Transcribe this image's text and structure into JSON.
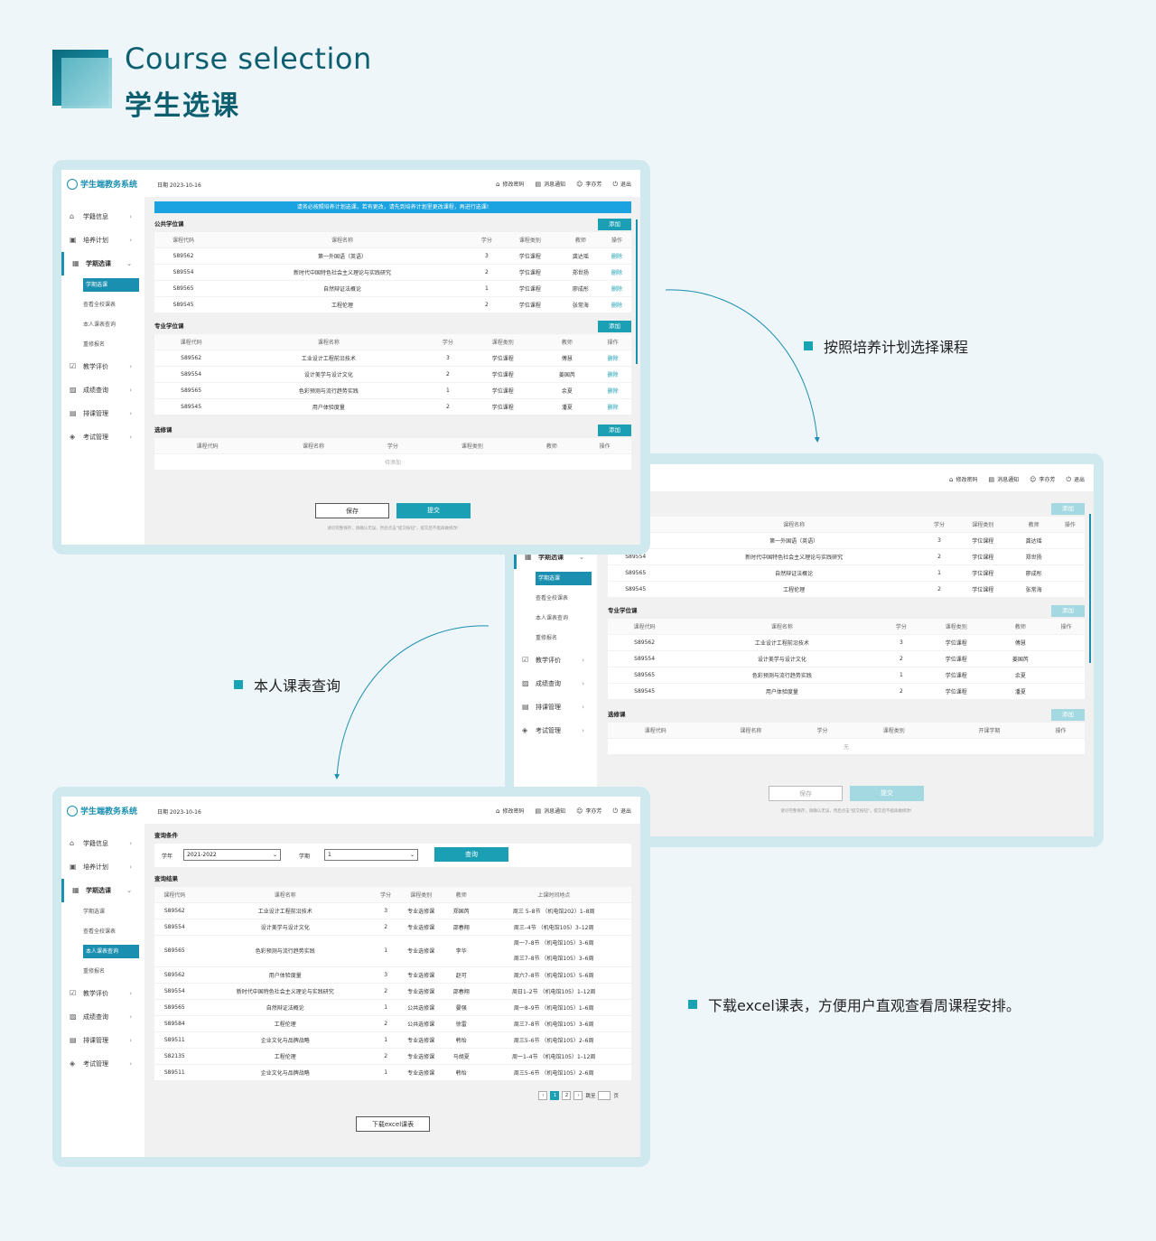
{
  "hero": {
    "title_en": "Course selection",
    "title_cn": "学生选课"
  },
  "annotations": {
    "a1": "按照培养计划选择课程",
    "a2": "本人课表查询",
    "a3": "下载excel课表，方便用户直观查看周课程安排。"
  },
  "app": {
    "logo": "学生端教务系统",
    "date": "日期  2023-10-16",
    "actions": [
      {
        "icon": "⌂",
        "label": "修改密码"
      },
      {
        "icon": "▤",
        "label": "消息通知"
      },
      {
        "icon": "☺",
        "label": "李亦芳"
      },
      {
        "icon": "⏻",
        "label": "退出"
      }
    ],
    "sidebar": {
      "items": [
        "学籍信息",
        "培养计划",
        "学期选课",
        "教学评价",
        "成绩查询",
        "排课管理",
        "考试管理"
      ],
      "subs": [
        "学期选课",
        "查看全校课表",
        "本人课表查询",
        "重修报名"
      ]
    }
  },
  "screen1": {
    "banner": "请务必按照培养计划选课，若有更改，请先到培养计划里更改课程，再进行选课!",
    "add_label": "添加",
    "headers": [
      "课程代码",
      "课程名称",
      "学分",
      "课程类别",
      "教师",
      "操作"
    ],
    "sections": [
      {
        "title": "公共学位课",
        "rows": [
          [
            "S89562",
            "第一外国语（英语）",
            "3",
            "学位课程",
            "龚达瑶",
            "删除"
          ],
          [
            "S89554",
            "新时代中国特色社会主义理论与实践研究",
            "2",
            "学位课程",
            "郑世扬",
            "删除"
          ],
          [
            "S89565",
            "自然辩证法概论",
            "1",
            "学位课程",
            "廖成彤",
            "删除"
          ],
          [
            "S89545",
            "工程伦理",
            "2",
            "学位课程",
            "张常海",
            "删除"
          ]
        ]
      },
      {
        "title": "专业学位课",
        "rows": [
          [
            "S89562",
            "工业设计工程前沿技术",
            "3",
            "学位课程",
            "傅慧",
            "删除"
          ],
          [
            "S89554",
            "设计美学与设计文化",
            "2",
            "学位课程",
            "姜国芮",
            "删除"
          ],
          [
            "S89565",
            "色彩预测与流行趋势实践",
            "1",
            "学位课程",
            "余夏",
            "删除"
          ],
          [
            "S89545",
            "用户体验度量",
            "2",
            "学位课程",
            "潘夏",
            "删除"
          ]
        ]
      }
    ],
    "elective_title": "选修课",
    "elective_empty": "待添加",
    "save": "保存",
    "submit": "提交",
    "note": "请尽完整保存，请确认无误，然后点击\"提交按钮\"，提交后不能再做修改!"
  },
  "screen2": {
    "headers1": [
      "",
      "课程名称",
      "学分",
      "课程类别",
      "教师",
      "操作"
    ],
    "headers2": [
      "课程代码",
      "课程名称",
      "学分",
      "课程类别",
      "教师",
      "操作"
    ],
    "headers3": [
      "课程代码",
      "课程名称",
      "学分",
      "课程类别",
      "开课学期",
      "操作"
    ],
    "sec2_title": "专业学位课",
    "sec3_title": "选修课",
    "rows1": [
      [
        "",
        "第一外国语（英语）",
        "3",
        "学位课程",
        "龚达瑶"
      ],
      [
        "S89554",
        "新时代中国特色社会主义理论与实践研究",
        "2",
        "学位课程",
        "郑世扬"
      ],
      [
        "S89565",
        "自然辩证法概论",
        "1",
        "学位课程",
        "廖成彤"
      ],
      [
        "S89545",
        "工程伦理",
        "2",
        "学位课程",
        "张常海"
      ]
    ],
    "rows2": [
      [
        "S89562",
        "工业设计工程前沿技术",
        "3",
        "学位课程",
        "傅慧"
      ],
      [
        "S89554",
        "设计美学与设计文化",
        "2",
        "学位课程",
        "姜国芮"
      ],
      [
        "S89565",
        "色彩预测与流行趋势实践",
        "1",
        "学位课程",
        "余夏"
      ],
      [
        "S89545",
        "用户体验度量",
        "2",
        "学位课程",
        "潘夏"
      ]
    ],
    "empty": "无",
    "note": "请尽完整保存，请确认无误，然后点击\"提交按钮\"，提交后不能再做修改!"
  },
  "screen3": {
    "filter_title": "查询条件",
    "year_label": "学年",
    "year_value": "2021-2022",
    "term_label": "学期",
    "term_value": "1",
    "query": "查询",
    "result_title": "查询结果",
    "headers": [
      "课程代码",
      "课程名称",
      "学分",
      "课程类别",
      "教师",
      "上课时间地点"
    ],
    "rows": [
      [
        "S89562",
        "工业设计工程前沿技术",
        "3",
        "专业选修课",
        "郑国芮",
        "周三 5–8节 （机电馆202）1–8周"
      ],
      [
        "S89554",
        "设计美学与设计文化",
        "2",
        "专业选修课",
        "邵春翔",
        "周三–4节 （机电馆105）3–12周"
      ],
      [
        "S89565",
        "色彩预测与流行趋势实践",
        "1",
        "专业选修课",
        "李华",
        "周一7–8节 （机电馆105）3–6周\n周三7–8节 （机电馆105）3–6周"
      ],
      [
        "S89562",
        "用户体验度量",
        "3",
        "专业选修课",
        "赵可",
        "周六7–8节 （机电馆105）5–6周"
      ],
      [
        "S89554",
        "新时代中国特色社会主义理论与实践研究",
        "2",
        "专业选修课",
        "邵春翔",
        "周日1–2节 （机电馆105）1–12周"
      ],
      [
        "S89565",
        "自然辩证法概论",
        "1",
        "公共选修课",
        "晏强",
        "周一8–9节 （机电馆105）1–6周"
      ],
      [
        "S89584",
        "工程伦理",
        "2",
        "公共选修课",
        "徐雷",
        "周三7–8节 （机电馆105）3–6周"
      ],
      [
        "S89511",
        "企业文化与品牌战略",
        "1",
        "专业选修课",
        "韩怡",
        "周三5–6节 （机电馆105）2–6周"
      ],
      [
        "S82135",
        "工程伦理",
        "2",
        "专业选修课",
        "马胡夏",
        "周一1–4节 （机电馆105）1–12周"
      ],
      [
        "S89511",
        "企业文化与品牌战略",
        "1",
        "专业选修课",
        "韩怡",
        "周三5–6节 （机电馆105）2–6周"
      ]
    ],
    "pager": {
      "prev": "‹",
      "p1": "1",
      "p2": "2",
      "next": "›",
      "goto": "跳至",
      "page": "页"
    },
    "download": "下载excel课表"
  }
}
